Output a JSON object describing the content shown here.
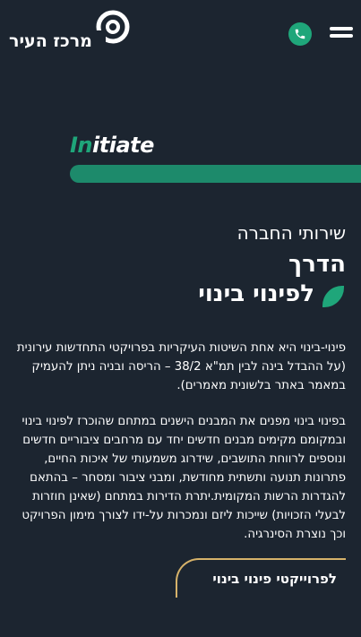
{
  "header": {
    "logo_text": "מרכז העיר",
    "phone_icon": "phone-icon",
    "menu_icon": "hamburger-menu-icon"
  },
  "brand": {
    "initiate_prefix": "In",
    "initiate_rest": "itiate",
    "accent_color": "#1fa67a",
    "gold_color": "#d6b26a"
  },
  "content": {
    "section_title": "שירותי החברה",
    "headline_line1": "הדרך",
    "headline_line2": "לפינוי בינוי",
    "paragraph1": "פינוי-בינוי היא אחת השיטות העיקריות בפרויקטי התחדשות עירונית (על ההבדל בינה לבין תמ\"א 38/2 – הריסה ובניה ניתן להעמיק במאמר באתר בלשונית מאמרים).",
    "paragraph2": "בפינוי בינוי מפנים את המבנים הישנים במתחם שהוכרז לפינוי בינוי ובמקומם מקימים מבנים חדשים יחד עם מרחבים ציבוריים חדשים ונוספים לרווחת התושבים, שידרוג משמעותי של איכות החיים, פתרונות תנועה ותשתית מחודשת, ומבני ציבור ומסחר – בהתאם להגדרות הרשות המקומית.יתרת הדירות במתחם (שאינן חוזרות לבעלי הזכויות) שייכות ליזם ונמכרות על-ידו לצורך מימון הפרויקט וכך נוצרת הסינרגיה."
  },
  "cta": {
    "label": "לפרוייקטי פינוי בינוי"
  }
}
